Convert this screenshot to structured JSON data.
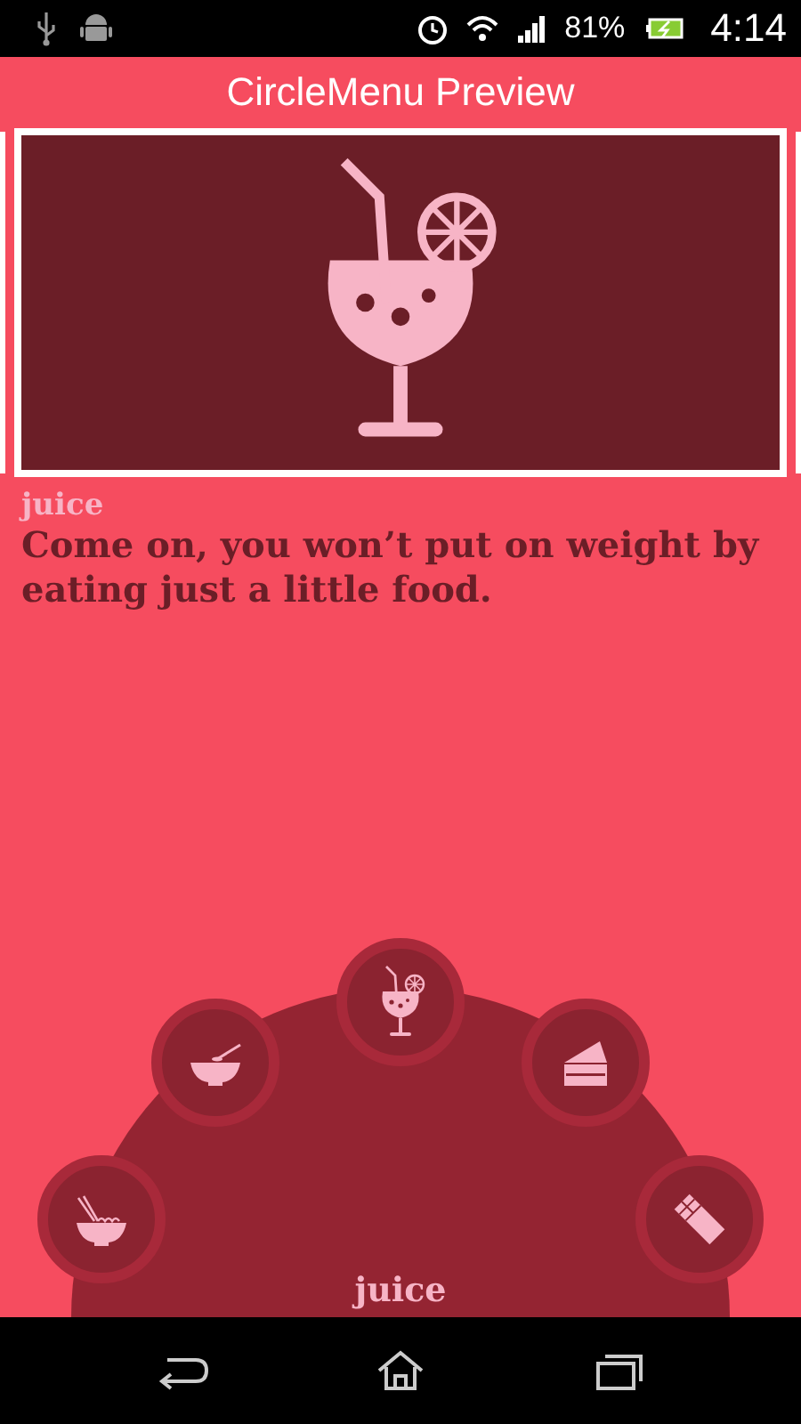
{
  "status_bar": {
    "battery": "81%",
    "time": "4:14"
  },
  "title": "CircleMenu Preview",
  "card": {
    "kind": "juice"
  },
  "detail": {
    "name": "juice",
    "description": "Come on, you won’t put on weight by eating just a little food."
  },
  "circle_menu": {
    "label": "juice",
    "items": [
      {
        "kind": "noodles"
      },
      {
        "kind": "rice"
      },
      {
        "kind": "juice"
      },
      {
        "kind": "cake"
      },
      {
        "kind": "chocolate"
      }
    ]
  }
}
